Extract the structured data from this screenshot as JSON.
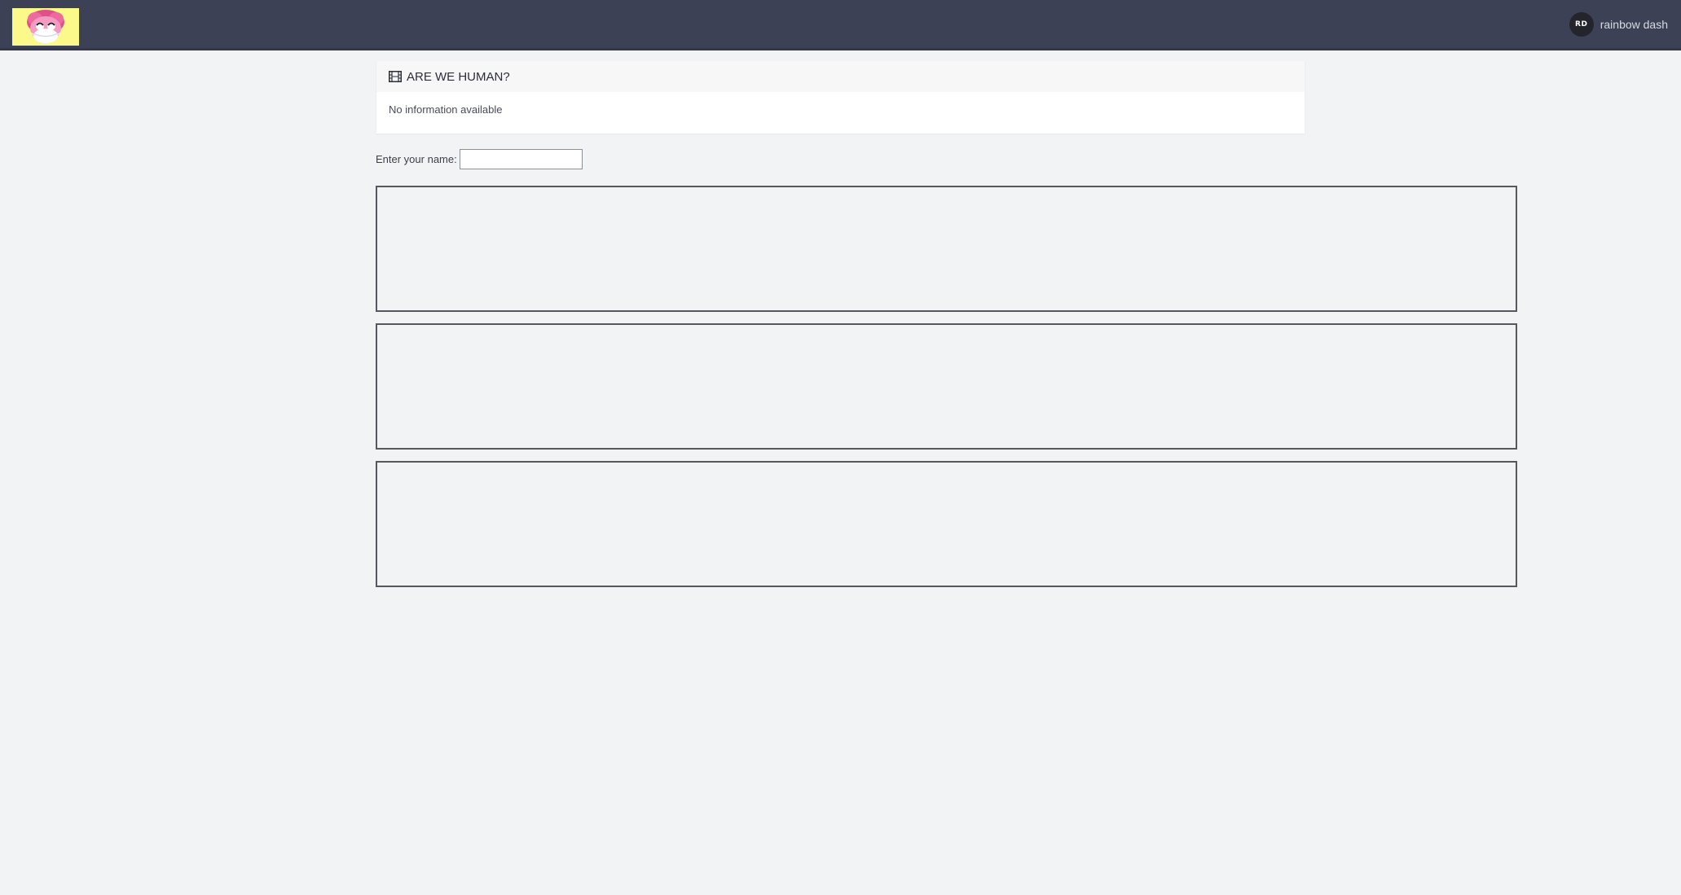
{
  "header": {
    "logo_icon": "pony-face-logo",
    "user": {
      "initials": "RD",
      "name": "rainbow dash"
    }
  },
  "card": {
    "icon": "film-icon",
    "title": "ARE WE HUMAN?",
    "body": "No information available"
  },
  "form": {
    "name_label": "Enter your name:",
    "name_value": "",
    "name_placeholder": ""
  },
  "frames": [
    {
      "id": "frame-1"
    },
    {
      "id": "frame-2"
    },
    {
      "id": "frame-3"
    }
  ],
  "colors": {
    "topbar": "#3d4155",
    "logo_bg": "#fbf98a",
    "background": "#f2f3f5"
  }
}
